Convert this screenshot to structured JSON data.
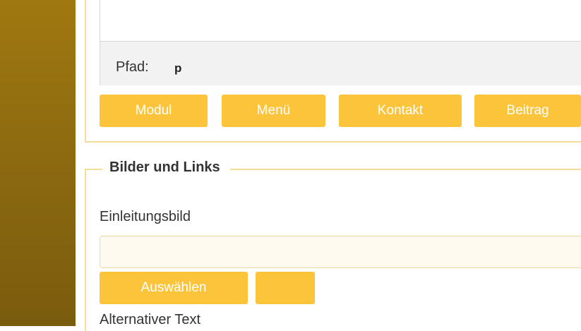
{
  "editor": {
    "path_label": "Pfad:",
    "path_value": "p"
  },
  "editor_buttons": [
    {
      "label": "Modul"
    },
    {
      "label": "Menü"
    },
    {
      "label": "Kontakt"
    },
    {
      "label": "Beitrag"
    }
  ],
  "images_section": {
    "legend": "Bilder und Links",
    "intro_image_label": "Einleitungsbild",
    "intro_image_value": "",
    "select_button_label": "Auswählen",
    "clear_button_label": "",
    "alt_text_label": "Alternativer Text"
  },
  "colors": {
    "accent": "#fcc43a",
    "sidebar": "#8a6810",
    "fieldset_border": "#f5dc9a"
  }
}
